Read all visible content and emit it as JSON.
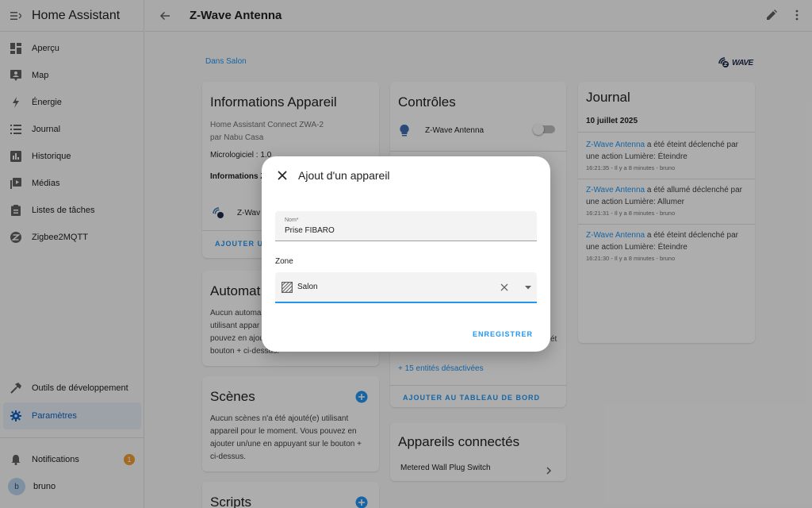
{
  "app": {
    "title": "Home Assistant"
  },
  "sidebar": {
    "items": [
      {
        "label": "Aperçu",
        "icon": "dashboard-icon"
      },
      {
        "label": "Map",
        "icon": "map-icon"
      },
      {
        "label": "Énergie",
        "icon": "lightning-icon"
      },
      {
        "label": "Journal",
        "icon": "list-icon"
      },
      {
        "label": "Historique",
        "icon": "chart-icon"
      },
      {
        "label": "Médias",
        "icon": "media-icon"
      },
      {
        "label": "Listes de tâches",
        "icon": "clipboard-icon"
      },
      {
        "label": "Zigbee2MQTT",
        "icon": "zigbee-icon"
      }
    ],
    "dev_tools": "Outils de développement",
    "settings": "Paramètres",
    "notifications": "Notifications",
    "notifications_count": "1",
    "user": "bruno",
    "user_initial": "b"
  },
  "topbar": {
    "title": "Z-Wave Antenna"
  },
  "breadcrumb": "Dans Salon",
  "zwave_logo_text": "WAVE",
  "info_card": {
    "title": "Informations Appareil",
    "model": "Home Assistant Connect ZWA-2",
    "manufacturer": "par Nabu Casa",
    "firmware": "Micrologiciel : 1.0",
    "section": "Informations Z",
    "integration": "Z-Wav",
    "action": "AJOUTER UN"
  },
  "automations_card": {
    "title": "Automat",
    "text_lines": [
      "Aucun automat",
      "utilisant appar",
      "pouvez en ajout",
      "bouton + ci-dessus."
    ]
  },
  "scenes_card": {
    "title": "Scènes",
    "text_lines": [
      "Aucun scènes n'a été ajouté(e) utilisant",
      "appareil pour le moment. Vous pouvez en",
      "ajouter un/une en appuyant sur le bouton +",
      "ci-dessus."
    ]
  },
  "scripts_card": {
    "title": "Scripts"
  },
  "controls_card": {
    "title": "Contrôles",
    "entity": "Z-Wave Antenna",
    "fragment": "ét",
    "disabled_entities": "+ 15 entités désactivées",
    "action": "AJOUTER AU TABLEAU DE BORD"
  },
  "connected_card": {
    "title": "Appareils connectés",
    "device": "Metered Wall Plug Switch"
  },
  "journal": {
    "title": "Journal",
    "date": "10 juillet 2025",
    "entries": [
      {
        "entity": "Z-Wave Antenna",
        "text": " a été éteint déclenché par",
        "text2": "une action Lumière: Éteindre",
        "meta": "16:21:35 - Il y a 8 minutes - bruno"
      },
      {
        "entity": "Z-Wave Antenna",
        "text": " a été allumé déclenché par",
        "text2": "une action Lumière: Allumer",
        "meta": "16:21:31 - Il y a 8 minutes - bruno"
      },
      {
        "entity": "Z-Wave Antenna",
        "text": " a été éteint déclenché par",
        "text2": "une action Lumière: Éteindre",
        "meta": "16:21:30 - Il y a 8 minutes - bruno"
      }
    ]
  },
  "dialog": {
    "title": "Ajout d'un appareil",
    "name_label": "Nom*",
    "name_value": "Prise FIBARO",
    "zone_label": "Zone",
    "zone_value": "Salon",
    "save_label": "ENREGISTRER"
  },
  "colors": {
    "accent": "#2196f3",
    "badge": "#f19c34",
    "active_bg": "#e8eef8"
  }
}
